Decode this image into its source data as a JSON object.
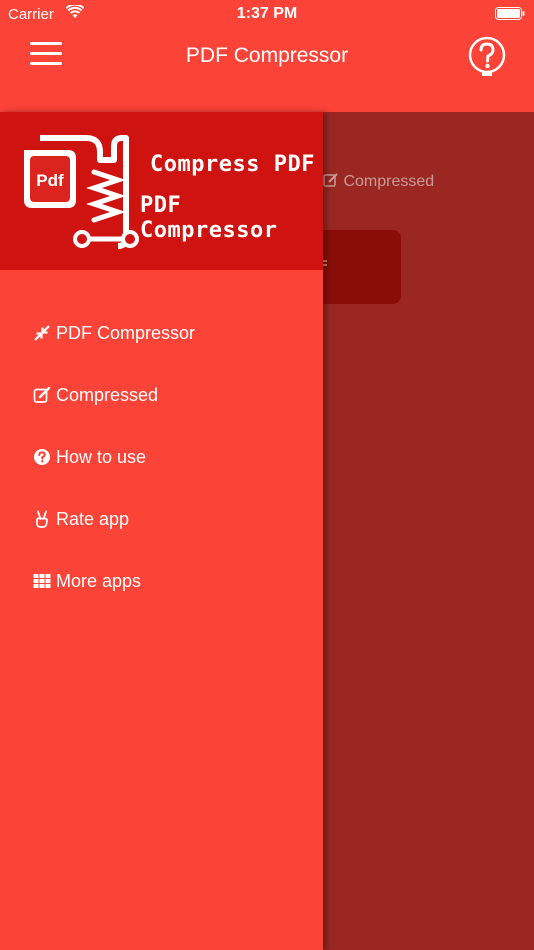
{
  "status_bar": {
    "carrier": "Carrier",
    "time": "1:37 PM"
  },
  "nav": {
    "title": "PDF Compressor",
    "menu_icon": "hamburger-icon",
    "help_icon": "question-circle-icon"
  },
  "drawer": {
    "logo": {
      "badge_text": "Pdf",
      "line1": "Compress PDF",
      "line2": "PDF Compressor"
    },
    "items": [
      {
        "label": "PDF Compressor",
        "icon": "compress-arrows-icon"
      },
      {
        "label": "Compressed",
        "icon": "edit-icon"
      },
      {
        "label": "How to use",
        "icon": "question-circle-icon"
      },
      {
        "label": "Rate app",
        "icon": "victory-hand-icon"
      },
      {
        "label": "More apps",
        "icon": "grid-icon"
      }
    ]
  },
  "main": {
    "compressed_tab": "Compressed"
  },
  "colors": {
    "primary": "#fc4338",
    "header_dark": "#ce1311",
    "overlay": "#9a2722",
    "text": "#ffffff"
  }
}
